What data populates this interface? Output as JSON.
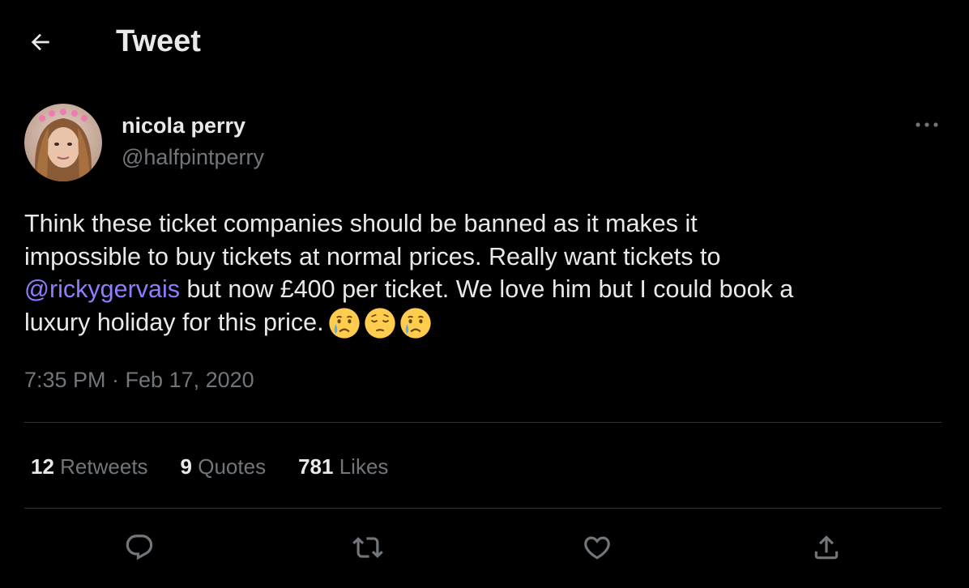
{
  "header": {
    "title": "Tweet",
    "back_icon": "arrow-left-icon"
  },
  "author": {
    "name": "nicola perry",
    "handle": "@halfpintperry"
  },
  "tweet": {
    "text_line1": "Think these ticket companies should be banned as it makes it",
    "text_line2": "impossible to buy tickets at normal prices. Really want tickets to",
    "mention": "@rickygervais",
    "text_line3_rest": " but now £400 per ticket. We love him but I could book a",
    "text_line4": "luxury holiday for this price.",
    "emojis": [
      "crying-face-icon",
      "pensive-face-icon",
      "crying-face-icon"
    ],
    "timestamp": "7:35 PM · Feb 17, 2020"
  },
  "stats": {
    "retweets_count": "12",
    "retweets_label": "Retweets",
    "quotes_count": "9",
    "quotes_label": "Quotes",
    "likes_count": "781",
    "likes_label": "Likes"
  },
  "actions": [
    "reply-icon",
    "retweet-icon",
    "like-icon",
    "share-icon"
  ],
  "colors": {
    "background": "#000000",
    "text": "#e7e9ea",
    "secondary": "#71767b",
    "mention": "#8f7cff",
    "divider": "#2f3336"
  }
}
